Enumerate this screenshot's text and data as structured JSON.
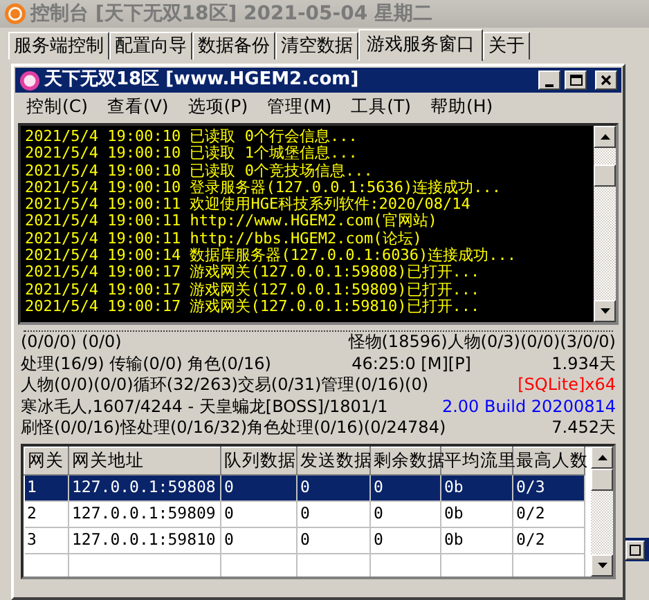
{
  "window": {
    "title": "控制台 [天下无双18区] 2021-05-04 星期二"
  },
  "tabs": [
    {
      "label": "服务端控制",
      "selected": false
    },
    {
      "label": "配置向导",
      "selected": false
    },
    {
      "label": "数据备份",
      "selected": false
    },
    {
      "label": "清空数据",
      "selected": false
    },
    {
      "label": "游戏服务窗口",
      "selected": true
    },
    {
      "label": "关于",
      "selected": false
    }
  ],
  "child_window": {
    "title": "天下无双18区 [www.HGEM2.com]",
    "menu": [
      "控制(C)",
      "查看(V)",
      "选项(P)",
      "管理(M)",
      "工具(T)",
      "帮助(H)"
    ],
    "log": [
      "2021/5/4 19:00:10 已读取 0个行会信息...",
      "2021/5/4 19:00:10 已读取 1个城堡信息...",
      "2021/5/4 19:00:10 已读取 0个竞技场信息...",
      "2021/5/4 19:00:10 登录服务器(127.0.0.1:5636)连接成功...",
      "2021/5/4 19:00:11 欢迎使用HGE科技系列软件:2020/08/14",
      "2021/5/4 19:00:11 http://www.HGEM2.com(官网站)",
      "2021/5/4 19:00:11 http://bbs.HGEM2.com(论坛)",
      "2021/5/4 19:00:14 数据库服务器(127.0.0.1:6036)连接成功...",
      "2021/5/4 19:00:17 游戏网关(127.0.0.1:59808)已打开...",
      "2021/5/4 19:00:17 游戏网关(127.0.0.1:59809)已打开...",
      "2021/5/4 19:00:17 游戏网关(127.0.0.1:59810)已打开..."
    ],
    "status_lines": [
      [
        {
          "text": "(0/0/0) (0/0)",
          "color": "#000000"
        },
        {
          "text": "怪物(18596)人物(0/3)(0/0)(3/0/0)",
          "color": "#000000"
        }
      ],
      [
        {
          "text": "处理(16/9) 传输(0/0) 角色(0/16)",
          "color": "#000000"
        },
        {
          "text": "46:25:0 [M][P]",
          "color": "#000000"
        },
        {
          "text": "1.934天",
          "color": "#000000"
        }
      ],
      [
        {
          "text": "人物(0/0)(0/0)循环(32/263)交易(0/31)管理(0/16)(0)",
          "color": "#000000"
        },
        {
          "text": "[SQLite]x64",
          "color": "#ff0000"
        }
      ],
      [
        {
          "text": "寒冰毛人,1607/4244 - 天皇蝙龙[BOSS]/1801/1",
          "color": "#000000"
        },
        {
          "text": "2.00 Build 20200814",
          "color": "#0000ff"
        }
      ],
      [
        {
          "text": "刷怪(0/0/16)怪处理(0/16/32)角色处理(0/16)(0/24784)",
          "color": "#000000"
        },
        {
          "text": "7.452天",
          "color": "#000000"
        }
      ]
    ],
    "table": {
      "columns": [
        "网关",
        "网关地址",
        "队列数据",
        "发送数据",
        "剩余数据",
        "平均流里",
        "最高人数"
      ],
      "rows": [
        {
          "cells": [
            "1",
            "127.0.0.1:59808",
            "0",
            "0",
            "0",
            "0b",
            "0/3"
          ],
          "selected": true
        },
        {
          "cells": [
            "2",
            "127.0.0.1:59809",
            "0",
            "0",
            "0",
            "0b",
            "0/2"
          ],
          "selected": false
        },
        {
          "cells": [
            "3",
            "127.0.0.1:59810",
            "0",
            "0",
            "0",
            "0b",
            "0/2"
          ],
          "selected": false
        }
      ]
    }
  }
}
